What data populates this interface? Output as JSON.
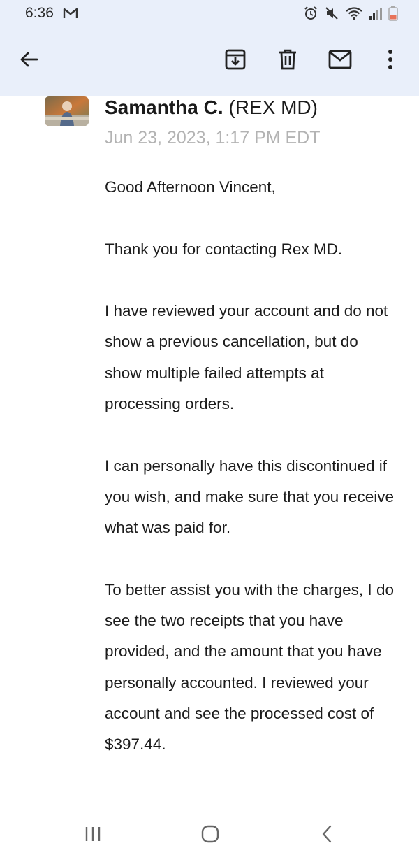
{
  "status_bar": {
    "time": "6:36"
  },
  "app_bar": {
    "icons": [
      "back-arrow-icon",
      "archive-icon",
      "trash-icon",
      "mail-icon",
      "more-vert-icon"
    ]
  },
  "email": {
    "sender_name": "Samantha C.",
    "sender_org": "(REX MD)",
    "date": "Jun 23, 2023, 1:17 PM EDT",
    "paragraphs": [
      "Good Afternoon Vincent,",
      "Thank you for contacting Rex MD.",
      "I have reviewed your account and do not show a previous cancellation, but do show multiple failed attempts at processing orders.",
      "I can personally have this discontinued if you wish, and make sure that you receive what was paid for.",
      "To better assist you with the charges, I do see the two receipts that you have provided, and the amount that you have personally accounted. I reviewed your account and see the processed cost of $397.44."
    ]
  },
  "nav_bar": {
    "icons": [
      "recents-icon",
      "home-icon",
      "nav-back-icon"
    ]
  },
  "colors": {
    "header_bg": "#e9effa",
    "date_text": "#b3b3b3",
    "battery": "#e8735a"
  }
}
